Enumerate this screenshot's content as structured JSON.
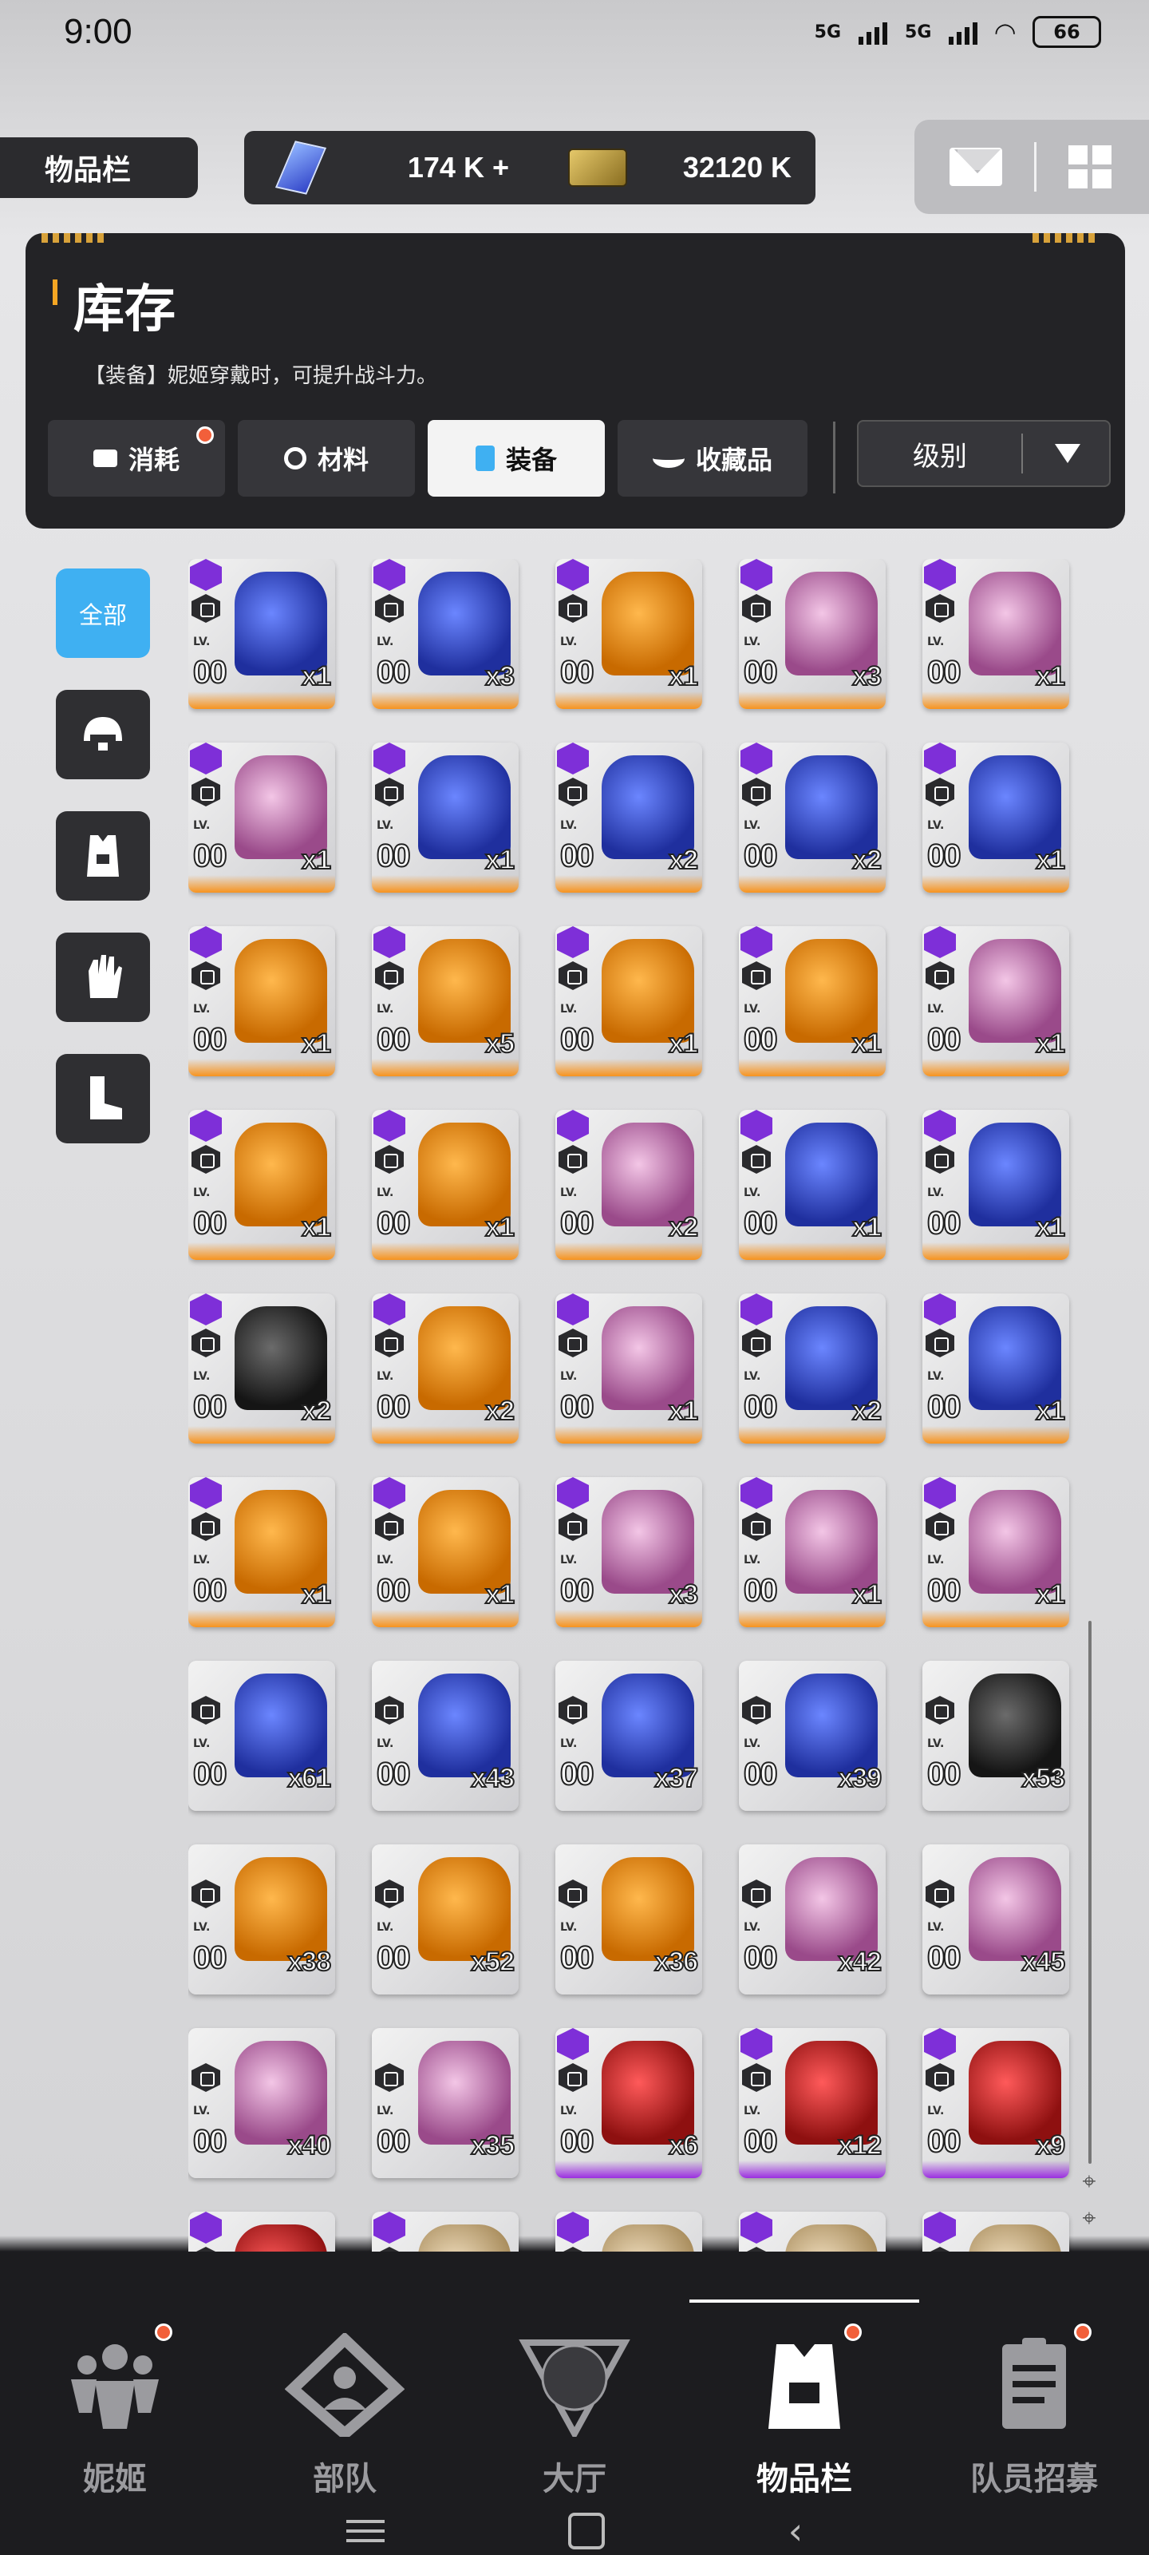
{
  "status_bar": {
    "time": "9:00",
    "network1": "5G",
    "network2": "5G",
    "battery": "66"
  },
  "header": {
    "page_label": "物品栏",
    "crystal_amount": "174 K",
    "crystal_plus": "+",
    "ticket_amount": "32120 K",
    "icons": [
      "mail-icon",
      "grid-menu-icon"
    ]
  },
  "panel": {
    "title": "库存",
    "description": "【装备】妮姬穿戴时，可提升战斗力。",
    "tabs": [
      {
        "label": "消耗",
        "icon": "battery-icon",
        "notify": true
      },
      {
        "label": "材料",
        "icon": "material-icon",
        "notify": false
      },
      {
        "label": "装备",
        "icon": "vest-icon",
        "notify": false,
        "active": true
      },
      {
        "label": "收藏品",
        "icon": "collectible-icon",
        "notify": false
      }
    ],
    "sort_label": "级别"
  },
  "categories": [
    {
      "label": "全部",
      "active": true
    },
    {
      "label": "",
      "icon": "helmet-icon"
    },
    {
      "label": "",
      "icon": "armor-icon"
    },
    {
      "label": "",
      "icon": "glove-icon"
    },
    {
      "label": "",
      "icon": "boot-icon"
    }
  ],
  "items": [
    {
      "rarity": "orange",
      "purple_tier": true,
      "art": "blue",
      "level": "00",
      "qty": "x1"
    },
    {
      "rarity": "orange",
      "purple_tier": true,
      "art": "blue",
      "level": "00",
      "qty": "x3"
    },
    {
      "rarity": "orange",
      "purple_tier": true,
      "art": "orange",
      "level": "00",
      "qty": "x1"
    },
    {
      "rarity": "orange",
      "purple_tier": true,
      "art": "pink",
      "level": "00",
      "qty": "x3"
    },
    {
      "rarity": "orange",
      "purple_tier": true,
      "art": "pink",
      "level": "00",
      "qty": "x1"
    },
    {
      "rarity": "orange",
      "purple_tier": true,
      "art": "pink",
      "level": "00",
      "qty": "x1"
    },
    {
      "rarity": "orange",
      "purple_tier": true,
      "art": "blue",
      "level": "00",
      "qty": "x1"
    },
    {
      "rarity": "orange",
      "purple_tier": true,
      "art": "blue",
      "level": "00",
      "qty": "x2"
    },
    {
      "rarity": "orange",
      "purple_tier": true,
      "art": "blue",
      "level": "00",
      "qty": "x2"
    },
    {
      "rarity": "orange",
      "purple_tier": true,
      "art": "blue",
      "level": "00",
      "qty": "x1"
    },
    {
      "rarity": "orange",
      "purple_tier": true,
      "art": "orange",
      "level": "00",
      "qty": "x1"
    },
    {
      "rarity": "orange",
      "purple_tier": true,
      "art": "orange",
      "level": "00",
      "qty": "x5"
    },
    {
      "rarity": "orange",
      "purple_tier": true,
      "art": "orange",
      "level": "00",
      "qty": "x1"
    },
    {
      "rarity": "orange",
      "purple_tier": true,
      "art": "orange",
      "level": "00",
      "qty": "x1"
    },
    {
      "rarity": "orange",
      "purple_tier": true,
      "art": "pink",
      "level": "00",
      "qty": "x1"
    },
    {
      "rarity": "orange",
      "purple_tier": true,
      "art": "orange",
      "level": "00",
      "qty": "x1"
    },
    {
      "rarity": "orange",
      "purple_tier": true,
      "art": "orange",
      "level": "00",
      "qty": "x1"
    },
    {
      "rarity": "orange",
      "purple_tier": true,
      "art": "pink",
      "level": "00",
      "qty": "x2"
    },
    {
      "rarity": "orange",
      "purple_tier": true,
      "art": "blue",
      "level": "00",
      "qty": "x1"
    },
    {
      "rarity": "orange",
      "purple_tier": true,
      "art": "blue",
      "level": "00",
      "qty": "x1"
    },
    {
      "rarity": "orange",
      "purple_tier": true,
      "art": "black",
      "level": "00",
      "qty": "x2"
    },
    {
      "rarity": "orange",
      "purple_tier": true,
      "art": "orange",
      "level": "00",
      "qty": "x2"
    },
    {
      "rarity": "orange",
      "purple_tier": true,
      "art": "pink",
      "level": "00",
      "qty": "x1"
    },
    {
      "rarity": "orange",
      "purple_tier": true,
      "art": "blue",
      "level": "00",
      "qty": "x2"
    },
    {
      "rarity": "orange",
      "purple_tier": true,
      "art": "blue",
      "level": "00",
      "qty": "x1"
    },
    {
      "rarity": "orange",
      "purple_tier": true,
      "art": "orange",
      "level": "00",
      "qty": "x1"
    },
    {
      "rarity": "orange",
      "purple_tier": true,
      "art": "orange",
      "level": "00",
      "qty": "x1"
    },
    {
      "rarity": "orange",
      "purple_tier": true,
      "art": "pink",
      "level": "00",
      "qty": "x3"
    },
    {
      "rarity": "orange",
      "purple_tier": true,
      "art": "pink",
      "level": "00",
      "qty": "x1"
    },
    {
      "rarity": "orange",
      "purple_tier": true,
      "art": "pink",
      "level": "00",
      "qty": "x1"
    },
    {
      "rarity": "none",
      "purple_tier": false,
      "art": "blue",
      "level": "00",
      "qty": "x61"
    },
    {
      "rarity": "none",
      "purple_tier": false,
      "art": "blue",
      "level": "00",
      "qty": "x43"
    },
    {
      "rarity": "none",
      "purple_tier": false,
      "art": "blue",
      "level": "00",
      "qty": "x37"
    },
    {
      "rarity": "none",
      "purple_tier": false,
      "art": "blue",
      "level": "00",
      "qty": "x39"
    },
    {
      "rarity": "none",
      "purple_tier": false,
      "art": "black",
      "level": "00",
      "qty": "x53"
    },
    {
      "rarity": "none",
      "purple_tier": false,
      "art": "orange",
      "level": "00",
      "qty": "x38"
    },
    {
      "rarity": "none",
      "purple_tier": false,
      "art": "orange",
      "level": "00",
      "qty": "x52"
    },
    {
      "rarity": "none",
      "purple_tier": false,
      "art": "orange",
      "level": "00",
      "qty": "x36"
    },
    {
      "rarity": "none",
      "purple_tier": false,
      "art": "pink",
      "level": "00",
      "qty": "x42"
    },
    {
      "rarity": "none",
      "purple_tier": false,
      "art": "pink",
      "level": "00",
      "qty": "x45"
    },
    {
      "rarity": "none",
      "purple_tier": false,
      "art": "pink",
      "level": "00",
      "qty": "x40"
    },
    {
      "rarity": "none",
      "purple_tier": false,
      "art": "pink",
      "level": "00",
      "qty": "x35"
    },
    {
      "rarity": "purple",
      "purple_tier": true,
      "art": "red",
      "level": "00",
      "qty": "x6"
    },
    {
      "rarity": "purple",
      "purple_tier": true,
      "art": "red",
      "level": "00",
      "qty": "x12"
    },
    {
      "rarity": "purple",
      "purple_tier": true,
      "art": "red",
      "level": "00",
      "qty": "x9"
    },
    {
      "rarity": "none",
      "purple_tier": true,
      "art": "red",
      "level": "",
      "qty": ""
    },
    {
      "rarity": "none",
      "purple_tier": true,
      "art": "beige",
      "level": "",
      "qty": ""
    },
    {
      "rarity": "none",
      "purple_tier": true,
      "art": "beige",
      "level": "",
      "qty": ""
    },
    {
      "rarity": "none",
      "purple_tier": true,
      "art": "beige",
      "level": "",
      "qty": ""
    },
    {
      "rarity": "none",
      "purple_tier": true,
      "art": "beige",
      "level": "",
      "qty": ""
    }
  ],
  "lv_text": "LV.",
  "bottom_nav": [
    {
      "label": "妮姬",
      "icon": "nikke-icon",
      "notify": true
    },
    {
      "label": "部队",
      "icon": "squad-icon",
      "notify": false
    },
    {
      "label": "大厅",
      "icon": "lobby-icon",
      "notify": false
    },
    {
      "label": "物品栏",
      "icon": "inventory-icon",
      "notify": true,
      "active": true
    },
    {
      "label": "队员招募",
      "icon": "recruit-icon",
      "notify": true
    }
  ],
  "colors": {
    "accent_blue": "#3fb0f2",
    "rarity_orange": "#f7931e",
    "rarity_purple": "#9b2fe0",
    "notify_red": "#f25f3a"
  }
}
